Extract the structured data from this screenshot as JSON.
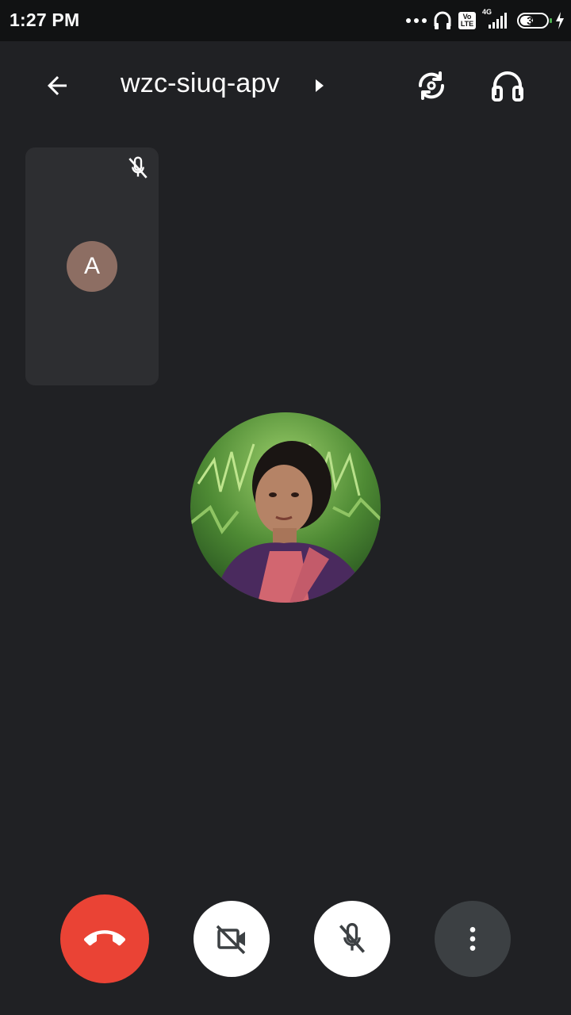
{
  "status_bar": {
    "time": "1:27 PM",
    "volte": "Vo LTE",
    "network": "4G",
    "battery": "38"
  },
  "header": {
    "meeting_code": "wzc-siuq-apv"
  },
  "self_tile": {
    "avatar_letter": "A"
  },
  "colors": {
    "background": "#202124",
    "end_call": "#ea4335",
    "avatar": "#8d6e63"
  },
  "icons": {
    "back": "arrow-back-icon",
    "flip": "switch-camera-icon",
    "audio": "headphones-icon",
    "mic_off": "mic-off-icon",
    "cam_off": "videocam-off-icon",
    "more": "more-vert-icon",
    "end_call": "call-end-icon"
  }
}
